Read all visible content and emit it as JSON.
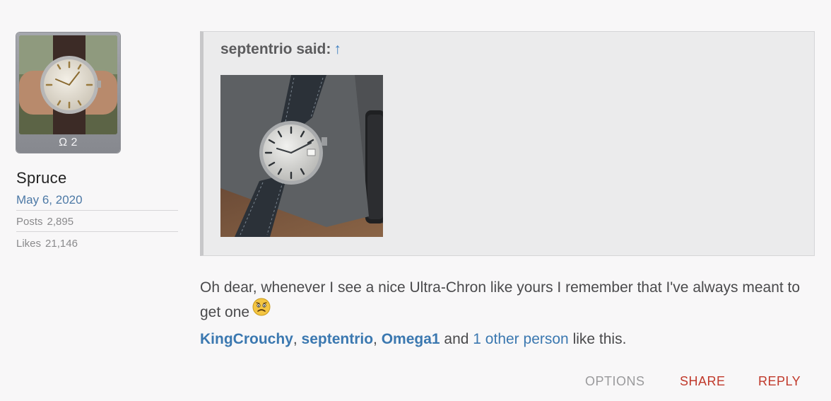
{
  "user": {
    "avatar_badge": "Ω 2",
    "username": "Spruce",
    "joined": "May 6, 2020",
    "posts_label": "Posts",
    "posts_value": "2,895",
    "likes_label": "Likes",
    "likes_value": "21,146"
  },
  "quote": {
    "author_said": "septentrio said:",
    "jump_arrow": "↑"
  },
  "post": {
    "text": "Oh dear, whenever I see a nice Ultra-Chron like yours I remember that I've always meant to get one",
    "emoji_icon": "worried-face-icon"
  },
  "likes": {
    "users": [
      "KingCrouchy",
      "septentrio",
      "Omega1"
    ],
    "sep": ", ",
    "and": " and ",
    "others_link": "1 other person",
    "suffix": " like this."
  },
  "actions": {
    "options": "OPTIONS",
    "share": "SHARE",
    "reply": "REPLY"
  },
  "colors": {
    "link": "#3b78b0",
    "action_red": "#c0392b",
    "arrow_blue": "#3f7fc0"
  }
}
